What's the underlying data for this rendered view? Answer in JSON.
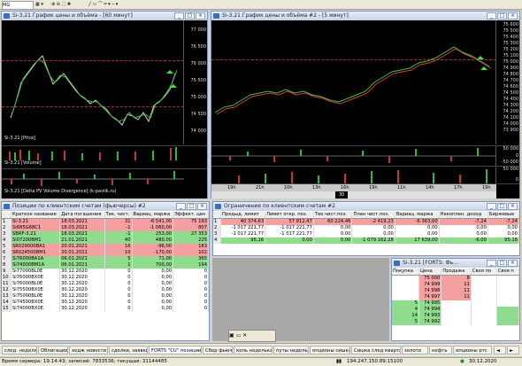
{
  "toolbar": {
    "instrument": "MG"
  },
  "chart60": {
    "title": "Si-3.21 График цены и объёма - [60 минут]",
    "price_tag": "Si-3.21 [Price]",
    "volume_tag": "Si-3.21 [Volume]",
    "pvd_tag": "Si-3.21 [Delta PV Volume Divergence] (k-pavlik.ru)",
    "yaxis": [
      "77 000",
      "76 500",
      "76 000",
      "75 500",
      "75 000",
      "74 500",
      "74 000"
    ]
  },
  "chart5": {
    "title": "Si-3.21 График цены и объёма #2 - [5 минут]",
    "yaxis": [
      "75 600",
      "75 500",
      "75 400",
      "75 300",
      "75 200",
      "75 100",
      "75 000",
      "74 900",
      "74 800",
      "74 700",
      "74 600",
      "74 500",
      "74 400",
      "74 300",
      "74 200",
      "74 100",
      "74 000",
      "73 900"
    ],
    "vol_axis": [
      "50 000",
      "0",
      "-50 000"
    ],
    "vol2_axis": [
      "50 000",
      "0"
    ],
    "xaxis": [
      "19h",
      "21h",
      "10h",
      "13h",
      "16h",
      "19h",
      "11h",
      "14h",
      "17h",
      "19h"
    ],
    "x_label": "30"
  },
  "positions": {
    "title": "Позиции по клиентским счетам (фьючерсы) #2",
    "columns": [
      "Краткое название",
      "Дата погашения",
      "Тек. чист.",
      "Вариац. маржа",
      "Эффект. цен"
    ],
    "rows": [
      {
        "n": "1",
        "name": "Si-3.21",
        "date": "18.03.2021",
        "net": "31",
        "var": "-6 541,00",
        "eff": "75 193",
        "style": "red"
      },
      {
        "n": "2",
        "name": "Si685G6BC1",
        "date": "18.03.2021",
        "net": "-1",
        "var": "-1 060,00",
        "eff": "807",
        "style": "red"
      },
      {
        "n": "3",
        "name": "SBRF-3.21",
        "date": "18.03.2021",
        "net": "-1",
        "var": "253,00",
        "eff": "27 353",
        "style": "green"
      },
      {
        "n": "4",
        "name": "Si07200BM1",
        "date": "21.01.2021",
        "net": "40",
        "var": "480,00",
        "eff": "225",
        "style": "green"
      },
      {
        "n": "5",
        "name": "SR029000BA1",
        "date": "20.01.2021",
        "net": "16",
        "var": "-96,00",
        "eff": "183",
        "style": "red"
      },
      {
        "n": "6",
        "name": "SR024500BM1",
        "date": "20.01.2021",
        "net": "10",
        "var": "-170,00",
        "eff": "102",
        "style": "red"
      },
      {
        "n": "7",
        "name": "Si76000BA1A",
        "date": "06.01.2021",
        "net": "5",
        "var": "71,00",
        "eff": "365",
        "style": "green"
      },
      {
        "n": "8",
        "name": "Si74000BM1A",
        "date": "06.01.2021",
        "net": "1",
        "var": "700,00",
        "eff": "194",
        "style": "green"
      },
      {
        "n": "9",
        "name": "Si77000BL0E",
        "date": "30.12.2020",
        "net": "0",
        "var": "0,00",
        "eff": "0",
        "style": "white"
      },
      {
        "n": "10",
        "name": "Si76000BX0E",
        "date": "30.12.2020",
        "net": "0",
        "var": "0,00",
        "eff": "0",
        "style": "white"
      },
      {
        "n": "11",
        "name": "Si76000BL0E",
        "date": "30.12.2020",
        "net": "0",
        "var": "0,00",
        "eff": "0",
        "style": "white"
      },
      {
        "n": "12",
        "name": "Si75500BX0E",
        "date": "30.12.2020",
        "net": "0",
        "var": "0,00",
        "eff": "0",
        "style": "white"
      },
      {
        "n": "13",
        "name": "Si75000BL0E",
        "date": "30.12.2020",
        "net": "0",
        "var": "0,00",
        "eff": "0",
        "style": "white"
      },
      {
        "n": "14",
        "name": "Si74500BX0E",
        "date": "30.12.2020",
        "net": "0",
        "var": "0,00",
        "eff": "0",
        "style": "white"
      },
      {
        "n": "15",
        "name": "Si74000BX0E",
        "date": "30.12.2020",
        "net": "0",
        "var": "0,00",
        "eff": "0",
        "style": "white"
      }
    ]
  },
  "limits": {
    "title": "Ограничения по клиентским счетам #2",
    "columns": [
      "Предыд. лимит",
      "Лимит откр. поз.",
      "Тек.чист.поз.",
      "План чист.поз.",
      "Вариац. маржа",
      "Накоплен. доход",
      "Биржевые"
    ],
    "rows": [
      {
        "n": "1",
        "c": [
          "40 374,63",
          "57 812,47",
          "60 224,46",
          "-2 419,23",
          "-6 363,00",
          "-7,24",
          "-7,24"
        ],
        "style": "red"
      },
      {
        "n": "2",
        "c": [
          "-1 017 221,77",
          "-1 017 221,77",
          "0,00",
          "0,00",
          "0,00",
          "0,00",
          "0,00"
        ],
        "style": "white"
      },
      {
        "n": "3",
        "c": [
          "-1 017 221,77",
          "-1 017 221,77",
          "0,00",
          "0,00",
          "0,00",
          "0,00",
          "0,00"
        ],
        "style": "white"
      },
      {
        "n": "4",
        "c": [
          "95,16",
          "0,00",
          "0,00",
          "-1 079 162,28",
          "17 639,00",
          "-6,00",
          "95,16"
        ],
        "style": "green"
      }
    ]
  },
  "orderbook": {
    "title": "Si-3.21 [FORTS: Фь...",
    "columns": [
      "Покупка",
      "Цена",
      "Продажа",
      "Своя по",
      "Своя п"
    ],
    "rows": [
      {
        "n": "",
        "buy": "",
        "price": "75 000",
        "sell": "8",
        "style": "red"
      },
      {
        "n": "",
        "buy": "",
        "price": "74 999",
        "sell": "11",
        "style": "red"
      },
      {
        "n": "",
        "buy": "",
        "price": "74 998",
        "sell": "11",
        "style": "red"
      },
      {
        "n": "",
        "buy": "",
        "price": "74 997",
        "sell": "11",
        "style": "red"
      },
      {
        "n": "5",
        "buy": "",
        "price": "74 995",
        "sell": "",
        "style": "green"
      },
      {
        "n": "4",
        "buy": "",
        "price": "74 994",
        "sell": "",
        "style": "green"
      },
      {
        "n": "14",
        "buy": "",
        "price": "74 993",
        "sell": "",
        "style": "green"
      },
      {
        "n": "5",
        "buy": "",
        "price": "74 992",
        "sell": "",
        "style": "green"
      }
    ]
  },
  "tabs": [
    "FORTS \"CU\" позиции",
    "Сбер фьюч",
    "коль неделька",
    "путы неделька",
    "опционы сишка",
    "Сишка след квартал",
    "золото",
    "нефть",
    "опционы ртс"
  ],
  "bottom_tabs": [
    "след. неделя",
    "Облигации",
    "хедж новости",
    "сделки, заявки"
  ],
  "status": {
    "server": "Время сервера: 19:14:43; записей: 7833536; текущая: 31144485",
    "ip": "194.247.150.89:15100",
    "date": "30.12.2020"
  }
}
